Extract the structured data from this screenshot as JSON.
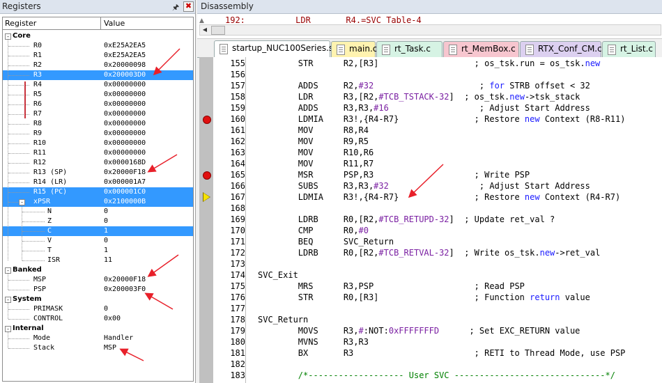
{
  "registers_pane": {
    "title": "Registers",
    "pin_icon": "pin-icon",
    "close_icon": "close-icon",
    "columns": [
      "Register",
      "Value"
    ],
    "rows": [
      {
        "name": "Core",
        "value": "",
        "level": 0,
        "group": true,
        "toggle": "-"
      },
      {
        "name": "R0",
        "value": "0xE25A2EA5",
        "level": 1
      },
      {
        "name": "R1",
        "value": "0xE25A2EA5",
        "level": 1
      },
      {
        "name": "R2",
        "value": "0x20000098",
        "level": 1
      },
      {
        "name": "R3",
        "value": "0x200003D0",
        "level": 1,
        "selected": true
      },
      {
        "name": "R4",
        "value": "0x00000000",
        "level": 1
      },
      {
        "name": "R5",
        "value": "0x00000000",
        "level": 1
      },
      {
        "name": "R6",
        "value": "0x00000000",
        "level": 1
      },
      {
        "name": "R7",
        "value": "0x00000000",
        "level": 1
      },
      {
        "name": "R8",
        "value": "0x00000000",
        "level": 1
      },
      {
        "name": "R9",
        "value": "0x00000000",
        "level": 1
      },
      {
        "name": "R10",
        "value": "0x00000000",
        "level": 1
      },
      {
        "name": "R11",
        "value": "0x00000000",
        "level": 1
      },
      {
        "name": "R12",
        "value": "0x0000168D",
        "level": 1
      },
      {
        "name": "R13 (SP)",
        "value": "0x20000F18",
        "level": 1
      },
      {
        "name": "R14 (LR)",
        "value": "0x000001A7",
        "level": 1
      },
      {
        "name": "R15 (PC)",
        "value": "0x000001C0",
        "level": 1,
        "selected": true
      },
      {
        "name": "xPSR",
        "value": "0x2100000B",
        "level": 1,
        "selected": true,
        "toggle": "-"
      },
      {
        "name": "N",
        "value": "0",
        "level": 2
      },
      {
        "name": "Z",
        "value": "0",
        "level": 2
      },
      {
        "name": "C",
        "value": "1",
        "level": 2,
        "selected": true
      },
      {
        "name": "V",
        "value": "0",
        "level": 2
      },
      {
        "name": "T",
        "value": "1",
        "level": 2
      },
      {
        "name": "ISR",
        "value": "11",
        "level": 2
      },
      {
        "name": "Banked",
        "value": "",
        "level": 0,
        "group": true,
        "toggle": "-"
      },
      {
        "name": "MSP",
        "value": "0x20000F18",
        "level": 1
      },
      {
        "name": "PSP",
        "value": "0x200003F0",
        "level": 1
      },
      {
        "name": "System",
        "value": "",
        "level": 0,
        "group": true,
        "toggle": "-"
      },
      {
        "name": "PRIMASK",
        "value": "0",
        "level": 1
      },
      {
        "name": "CONTROL",
        "value": "0x00",
        "level": 1
      },
      {
        "name": "Internal",
        "value": "",
        "level": 0,
        "group": true,
        "toggle": "-"
      },
      {
        "name": "Mode",
        "value": "Handler",
        "level": 1
      },
      {
        "name": "Stack",
        "value": "MSP",
        "level": 1
      }
    ]
  },
  "disassembly_pane": {
    "title": "Disassembly",
    "current_line": "192:          LDR       R4.=SVC Table-4",
    "tabs": [
      {
        "label": "startup_NUC100Series.s",
        "color": "#ffffff",
        "active": true
      },
      {
        "label": "main.c",
        "color": "#fff3b0"
      },
      {
        "label": "rt_Task.c",
        "color": "#d6f3e4"
      },
      {
        "label": "rt_MemBox.c",
        "color": "#f7c6cf"
      },
      {
        "label": "RTX_Conf_CM.c",
        "color": "#dcd0f0"
      },
      {
        "label": "rt_List.c",
        "color": "#d6f3e4"
      }
    ],
    "lines": [
      {
        "n": "155",
        "code": [
          [
            "        STR      R2,[R3]                   ; os_tsk.run = os_tsk.",
            ""
          ],
          [
            "new",
            "kw"
          ]
        ]
      },
      {
        "n": "156",
        "code": []
      },
      {
        "n": "157",
        "code": [
          [
            "        ADDS     R2,",
            ""
          ],
          [
            "#32",
            "num"
          ],
          [
            "                     ; ",
            ""
          ],
          [
            "for",
            "kw"
          ],
          [
            " STRB offset < 32",
            ""
          ]
        ]
      },
      {
        "n": "158",
        "code": [
          [
            "        LDR      R3,[R2,",
            ""
          ],
          [
            "#TCB_TSTACK-32",
            "num"
          ],
          [
            "]  ; os_tsk.",
            ""
          ],
          [
            "new",
            "kw"
          ],
          [
            "->tsk_stack",
            ""
          ]
        ]
      },
      {
        "n": "159",
        "code": [
          [
            "        ADDS     R3,R3,",
            ""
          ],
          [
            "#16",
            "num"
          ],
          [
            "                  ; Adjust Start Address",
            ""
          ]
        ]
      },
      {
        "n": "160",
        "bp": true,
        "code": [
          [
            "        LDMIA    R3!,{R4-R7}               ; Restore ",
            ""
          ],
          [
            "new",
            "kw"
          ],
          [
            " Context (R8-R11)",
            ""
          ]
        ]
      },
      {
        "n": "161",
        "code": [
          [
            "        MOV      R8,R4",
            ""
          ]
        ]
      },
      {
        "n": "162",
        "code": [
          [
            "        MOV      R9,R5",
            ""
          ]
        ]
      },
      {
        "n": "163",
        "code": [
          [
            "        MOV      R10,R6",
            ""
          ]
        ]
      },
      {
        "n": "164",
        "code": [
          [
            "        MOV      R11,R7",
            ""
          ]
        ]
      },
      {
        "n": "165",
        "bp": true,
        "code": [
          [
            "        MSR      PSP,R3                    ; Write PSP",
            ""
          ]
        ]
      },
      {
        "n": "166",
        "code": [
          [
            "        SUBS     R3,R3,",
            ""
          ],
          [
            "#32",
            "num"
          ],
          [
            "                  ; Adjust Start Address",
            ""
          ]
        ]
      },
      {
        "n": "167",
        "pc": true,
        "code": [
          [
            "        LDMIA    R3!,{R4-R7}               ; Restore ",
            ""
          ],
          [
            "new",
            "kw"
          ],
          [
            " Context (R4-R7)",
            ""
          ]
        ]
      },
      {
        "n": "168",
        "code": []
      },
      {
        "n": "169",
        "code": [
          [
            "        LDRB     R0,[R2,",
            ""
          ],
          [
            "#TCB_RETUPD-32",
            "num"
          ],
          [
            "]  ; Update ret_val ?",
            ""
          ]
        ]
      },
      {
        "n": "170",
        "code": [
          [
            "        CMP      R0,",
            ""
          ],
          [
            "#0",
            "num"
          ]
        ]
      },
      {
        "n": "171",
        "code": [
          [
            "        BEQ      SVC_Return",
            ""
          ]
        ]
      },
      {
        "n": "172",
        "code": [
          [
            "        LDRB     R0,[R2,",
            ""
          ],
          [
            "#TCB_RETVAL-32",
            "num"
          ],
          [
            "]  ; Write os_tsk.",
            ""
          ],
          [
            "new",
            "kw"
          ],
          [
            "->ret_val",
            ""
          ]
        ]
      },
      {
        "n": "173",
        "code": []
      },
      {
        "n": "174",
        "code": [
          [
            "SVC_Exit",
            ""
          ]
        ]
      },
      {
        "n": "175",
        "code": [
          [
            "        MRS      R3,PSP                    ; Read PSP",
            ""
          ]
        ]
      },
      {
        "n": "176",
        "code": [
          [
            "        STR      R0,[R3]                   ; Function ",
            ""
          ],
          [
            "return",
            "kw"
          ],
          [
            " value",
            ""
          ]
        ]
      },
      {
        "n": "177",
        "code": []
      },
      {
        "n": "178",
        "code": [
          [
            "SVC_Return",
            ""
          ]
        ]
      },
      {
        "n": "179",
        "code": [
          [
            "        MOVS     R3,",
            ""
          ],
          [
            "#",
            "num"
          ],
          [
            ":NOT:",
            ""
          ],
          [
            "0xFFFFFFFD",
            "num"
          ],
          [
            "      ; Set EXC_RETURN value",
            ""
          ]
        ]
      },
      {
        "n": "180",
        "code": [
          [
            "        MVNS     R3,R3",
            ""
          ]
        ]
      },
      {
        "n": "181",
        "code": [
          [
            "        BX       R3                        ; RETI to Thread Mode, use PSP",
            ""
          ]
        ]
      },
      {
        "n": "182",
        "code": []
      },
      {
        "n": "183",
        "code": [
          [
            "        /*------------------- User SVC ------------------------------*/",
            "cm"
          ]
        ]
      }
    ]
  },
  "colors": {
    "selection": "#3399ff",
    "keyword": "#1a1aff",
    "number": "#7a1fa2",
    "comment": "#008000",
    "breakpoint": "#e01010",
    "pc_marker": "#f6e200",
    "annotation": "#e8202a"
  }
}
